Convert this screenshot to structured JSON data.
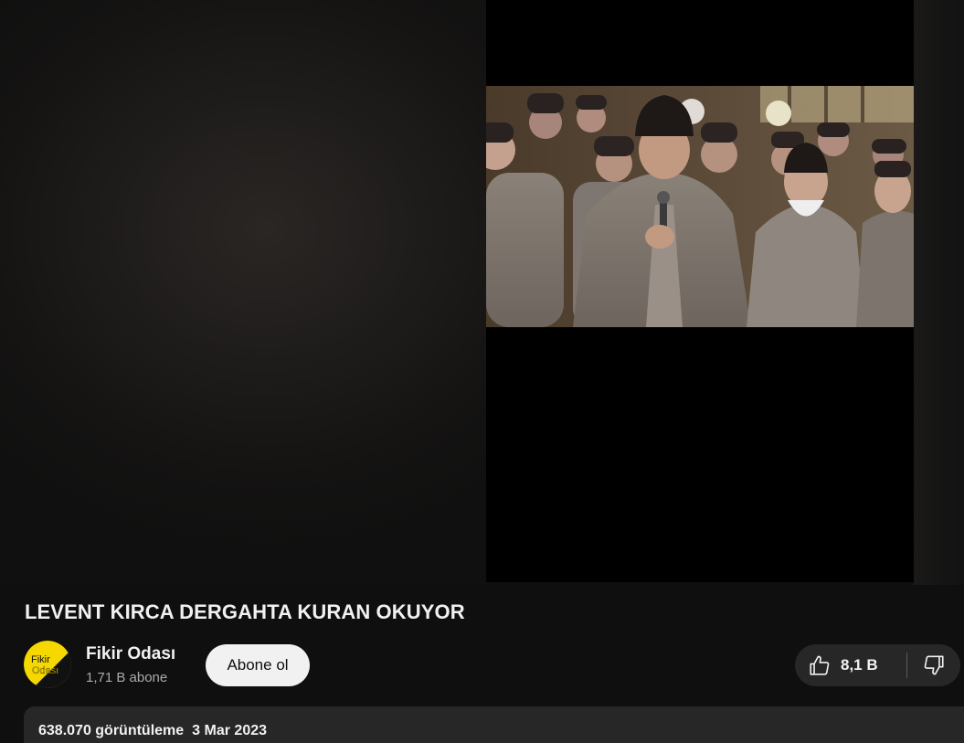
{
  "video": {
    "title": "LEVENT KIRCA DERGAHTA KURAN OKUYOR"
  },
  "channel": {
    "name": "Fikir Odası",
    "subscribers": "1,71 B abone",
    "avatar_text_line1": "Fikir",
    "avatar_text_line2": "Odası"
  },
  "actions": {
    "subscribe_label": "Abone ol",
    "like_count": "8,1 B",
    "like_icon": "thumbs-up-icon",
    "dislike_icon": "thumbs-down-icon"
  },
  "description": {
    "views": "638.070 görüntüleme",
    "date": "3 Mar 2023"
  },
  "colors": {
    "background": "#0f0f0f",
    "chip": "#272727",
    "subscribe_bg": "#f1f1f1",
    "avatar_yellow": "#f5d800"
  }
}
